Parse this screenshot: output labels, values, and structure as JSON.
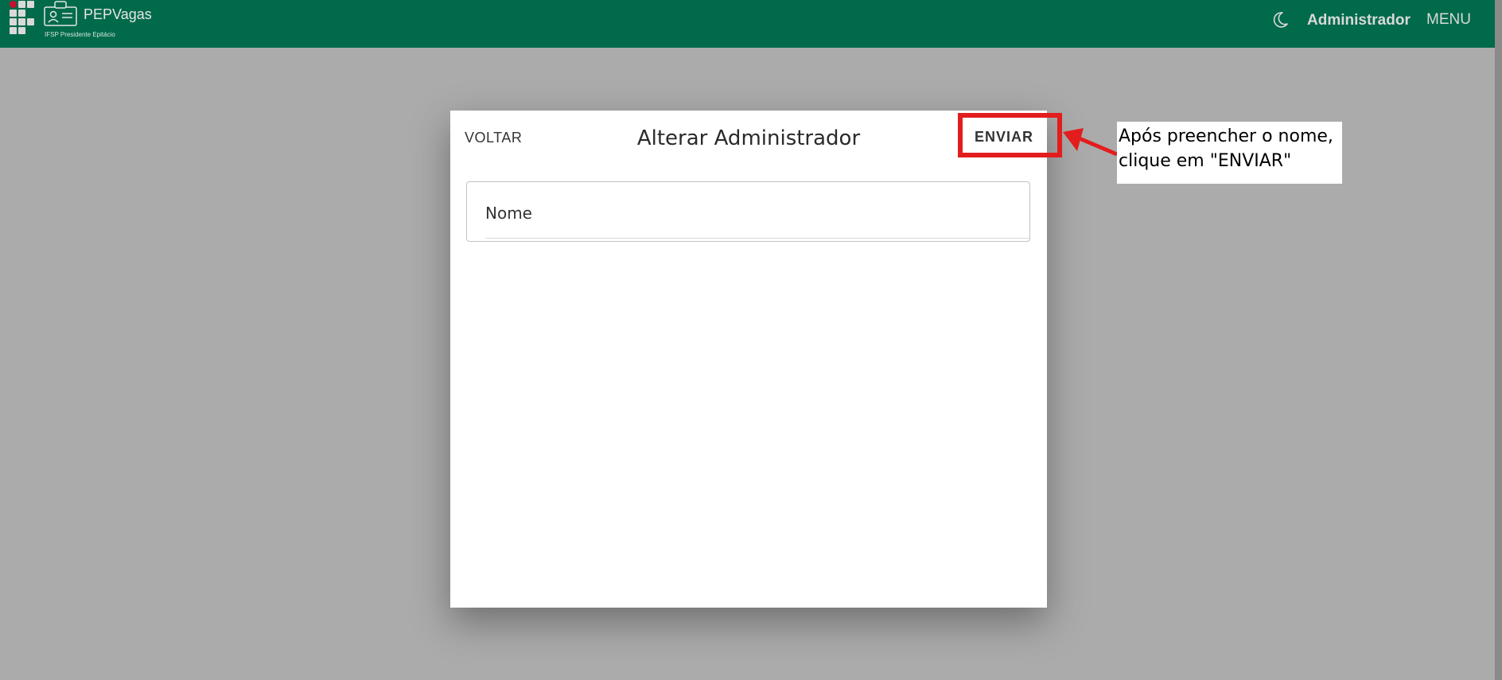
{
  "header": {
    "app_name": "PEPVagas",
    "subtitle": "IFSP Presidente Epitácio",
    "user_label": "Administrador",
    "menu_label": "MENU",
    "theme_icon": "moon-icon",
    "logo_icon": "ifsp-logo-icon",
    "app_icon": "id-card-icon"
  },
  "modal": {
    "back_label": "VOLTAR",
    "title": "Alterar Administrador",
    "submit_label": "ENVIAR",
    "fields": [
      {
        "label": "Nome",
        "value": ""
      }
    ]
  },
  "annotation": {
    "text_line1": "Após preencher o nome,",
    "text_line2": "clique em \"ENVIAR\"",
    "color": "#e31d1d"
  },
  "colors": {
    "header_bg": "#006a4a",
    "overlay_bg": "#ababab",
    "modal_bg": "#ffffff"
  }
}
